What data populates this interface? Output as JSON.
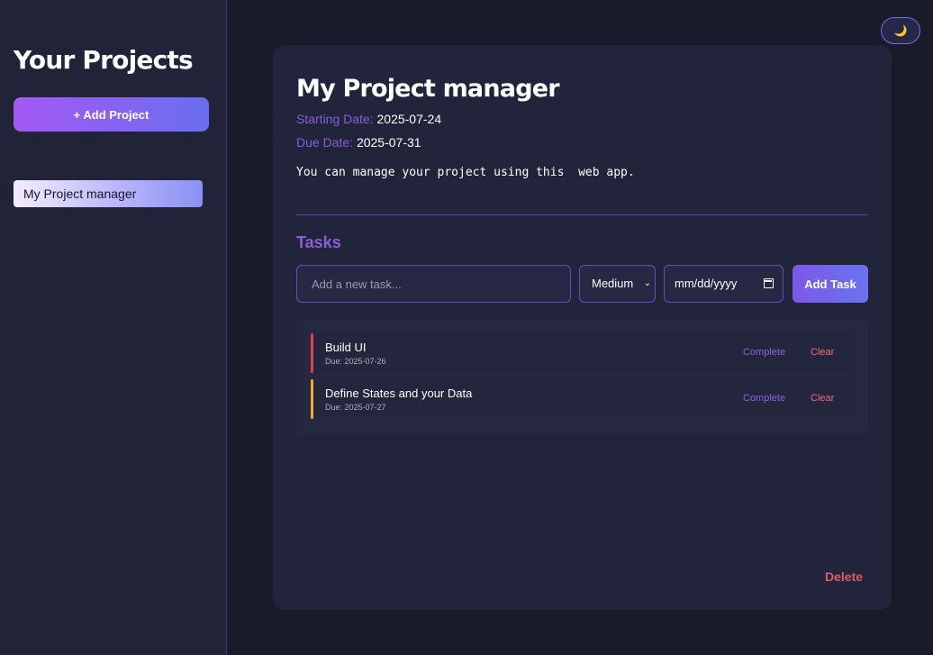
{
  "sidebar": {
    "title": "Your Projects",
    "add_project_label": "+ Add Project",
    "projects": [
      {
        "label": "My Project manager"
      }
    ]
  },
  "theme_toggle": {
    "icon": "moon-icon",
    "glyph": "🌙"
  },
  "project": {
    "title": "My Project manager",
    "start_label": "Starting Date:",
    "start_value": "2025-07-24",
    "due_label": "Due Date:",
    "due_value": "2025-07-31",
    "description": "You can manage your project using this  web app."
  },
  "tasks_section": {
    "heading": "Tasks",
    "input_placeholder": "Add a new task...",
    "priority_selected": "Medium",
    "date_placeholder": "mm/dd/yyyy",
    "add_task_label": "Add Task",
    "items": [
      {
        "name": "Build UI",
        "due": "Due: 2025-07-26",
        "complete_label": "Complete",
        "clear_label": "Clear",
        "priority_color": "#e0414d"
      },
      {
        "name": "Define States and your Data",
        "due": "Due: 2025-07-27",
        "complete_label": "Complete",
        "clear_label": "Clear",
        "priority_color": "#f0a93a"
      }
    ]
  },
  "delete_label": "Delete",
  "colors": {
    "accent_purple": "#8a5ed8",
    "danger": "#d95c6d",
    "background": "#1a1b2a"
  }
}
